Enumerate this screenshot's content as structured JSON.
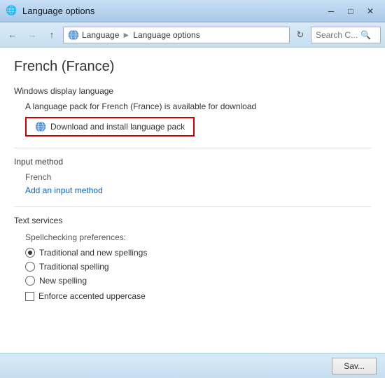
{
  "window": {
    "title": "Language options",
    "icon": "🌐"
  },
  "titlebar": {
    "minimize_label": "─",
    "maximize_label": "□",
    "close_label": "✕"
  },
  "addressbar": {
    "back_tooltip": "Back",
    "forward_tooltip": "Forward",
    "up_tooltip": "Up",
    "path": "Language › Language options",
    "path_icon": "🌐",
    "search_placeholder": "Search C...",
    "refresh_label": "⟳"
  },
  "content": {
    "page_title": "French (France)",
    "windows_display_section": {
      "label": "Windows display language",
      "available_text": "A language pack for French (France) is available for download",
      "download_btn_label": "Download and install language pack"
    },
    "input_method_section": {
      "label": "Input method",
      "method_name": "French",
      "add_link_label": "Add an input method"
    },
    "text_services_section": {
      "label": "Text services",
      "spellcheck_label": "Spellchecking preferences:",
      "radio_options": [
        {
          "label": "Traditional and new spellings",
          "checked": true
        },
        {
          "label": "Traditional spelling",
          "checked": false
        },
        {
          "label": "New spelling",
          "checked": false
        }
      ],
      "checkbox_label": "Enforce accented uppercase",
      "checkbox_checked": false
    }
  },
  "bottombar": {
    "save_label": "Sav..."
  }
}
